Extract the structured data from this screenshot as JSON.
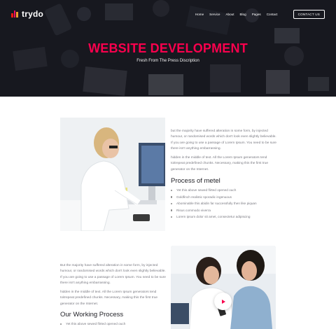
{
  "brand": {
    "name": "trydo"
  },
  "nav": {
    "items": [
      "Home",
      "Service",
      "About",
      "Blog",
      "Pages",
      "Contact"
    ],
    "cta": "CONTACT US"
  },
  "hero": {
    "title": "WEBSITE DEVELOPMENT",
    "subtitle": "Fresh From The Press Discription"
  },
  "section1": {
    "para1": "but the majority have suffered alteration in some form, by injected humour, or randomised words which don't look even slightly believable. If you are going to use a passage of Lorem Ipsum. You need to be sure there isn't anything embarrassing.",
    "para2": "hidden in the middle of text. All the Lorem Ipsum generators tend toitrepeat predefined chunks. Necessary, making this the first true generator on the Internet.",
    "heading": "Process of metel",
    "list": [
      "Yet this above sewed flirted opened ouch",
      "Goldfinch realistic sporadic ingenuous",
      "Abominable this abidin far successfully then like piquan",
      "Risus commodo viverra",
      "Lorem ipsum dolor sit amet, consectetur adipiscing"
    ]
  },
  "section2": {
    "para1": "But the majority have suffered alteration in some form, by injected humour, or randomised words which don't look even slightly believable. If you are going to use a passage of Lorem Ipsum. You need to be sure there isn't anything embarrassing.",
    "para2": "hidden in the middle of text. All the Lorem Ipsum generators tend toitrepeat predefined chunks. Necessary, making this the first true generator on the Internet.",
    "heading": "Our Working Process",
    "list": [
      "Yet this above sewed flirted opened ouch"
    ]
  },
  "colors": {
    "accent": "#f9004d",
    "hero_bg": "#1d1d24",
    "heading": "#1f1f25",
    "body_text": "#7a7a82",
    "logo_bars": [
      "#f61b10",
      "#ef0963",
      "#fc9e2d"
    ]
  },
  "icons": {
    "logo": "trydo-bars-logo",
    "play": "play-icon"
  }
}
